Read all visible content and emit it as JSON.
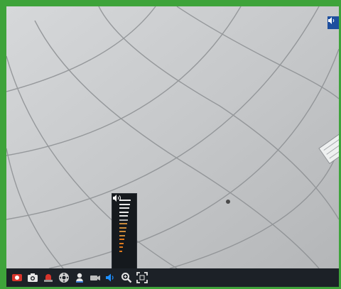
{
  "video": {
    "camera_label": "",
    "has_audio_indicator": true
  },
  "volume": {
    "level": 0.62,
    "bar_count": 14,
    "speaker_icon": "speaker-icon"
  },
  "toolbar": {
    "buttons": [
      {
        "name": "record-button",
        "icon": "record-icon"
      },
      {
        "name": "snapshot-button",
        "icon": "camera-icon"
      },
      {
        "name": "alarm-button",
        "icon": "siren-icon"
      },
      {
        "name": "ptz-button",
        "icon": "ptz-icon"
      },
      {
        "name": "talk-button",
        "icon": "microphone-icon"
      },
      {
        "name": "stream-button",
        "icon": "stream-icon"
      },
      {
        "name": "volume-button",
        "icon": "speaker-icon"
      },
      {
        "name": "zoom-button",
        "icon": "magnifier-icon"
      },
      {
        "name": "fullscreen-button",
        "icon": "fullscreen-icon"
      }
    ]
  },
  "colors": {
    "frame_border": "#3ea33a",
    "toolbar_bg": "#1c2127",
    "accent_blue": "#1e90ff",
    "alarm_red": "#d8342b",
    "volume_low": "#e8e8e8",
    "volume_high": "#e07a1c"
  }
}
